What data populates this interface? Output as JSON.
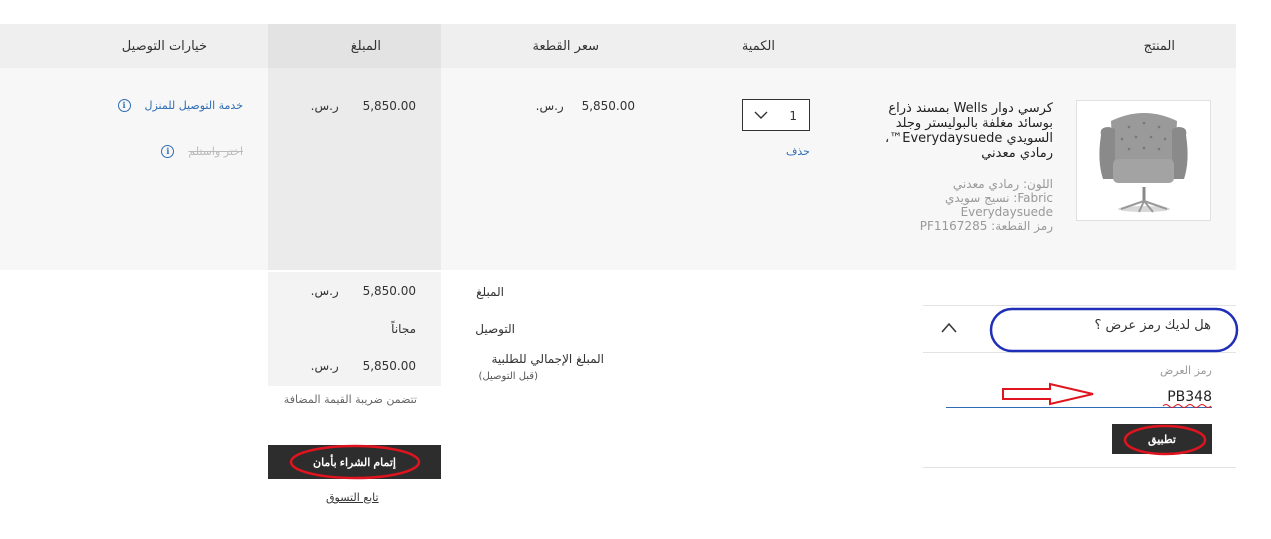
{
  "table": {
    "headers": {
      "product": "المنتج",
      "quantity": "الكمية",
      "unit_price": "سعر القطعة",
      "amount": "المبلغ",
      "delivery_options": "خيارات التوصيل"
    }
  },
  "item": {
    "name": "كرسي دوار Wells بمسند ذراع بوسائد مغلفة بالبوليستر وجلد السويدي Everydaysuede™، رمادي معدني",
    "color": "اللون: رمادي معدني",
    "fabric": "Fabric: نسيج سويدي Everydaysuede",
    "sku": "رمز القطعة: PF1167285",
    "quantity": "1",
    "delete_label": "حذف",
    "unit_price": "5,850.00",
    "amount": "5,850.00",
    "currency": "ر.س.",
    "delivery_home": "خدمة التوصيل للمنزل",
    "delivery_pickup": "اختر واستلم"
  },
  "summary": {
    "amount_label": "المبلغ",
    "amount_value": "5,850.00",
    "delivery_label": "التوصيل",
    "delivery_value": "مجاناً",
    "total_label": "المبلغ الإجمالي للطلبية",
    "total_sublabel": "(قبل التوصيل)",
    "total_value": "5,850.00",
    "currency": "ر.س.",
    "vat_note": "تتضمن ضريبة القيمة المضافة",
    "checkout_label": "إتمام الشراء بأمان",
    "continue_label": "تابع التسوق"
  },
  "promo": {
    "question": "هل لديك رمز عرض ؟",
    "field_label": "رمز العرض",
    "value": "PB348",
    "apply_label": "تطبيق"
  },
  "colors": {
    "link": "#2f6db5",
    "dark_button": "#2d2d2d",
    "annotation_red": "#e0141e",
    "annotation_blue": "#1f2fb8"
  }
}
